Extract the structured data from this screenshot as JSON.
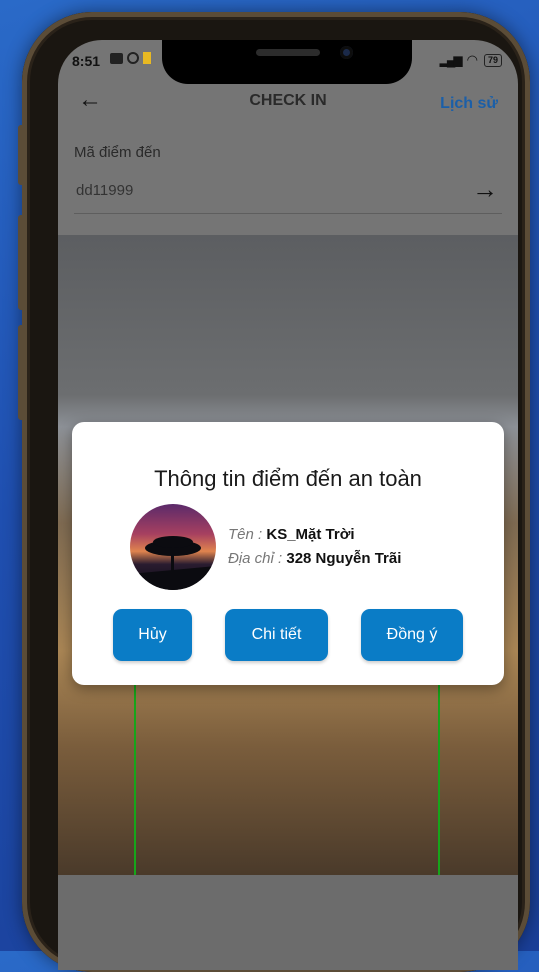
{
  "status_bar": {
    "time": "8:51",
    "battery": "79"
  },
  "header": {
    "title": "CHECK IN",
    "history_link": "Lịch sử"
  },
  "destination": {
    "label": "Mã điểm đến",
    "value": "dd11999"
  },
  "dialog": {
    "title": "Thông tin điểm đến an toàn",
    "name_label": "Tên :",
    "name_value": "KS_Mặt Trời",
    "address_label": "Địa chỉ :",
    "address_value": "328 Nguyễn Trãi",
    "buttons": {
      "cancel": "Hủy",
      "details": "Chi tiết",
      "agree": "Đồng ý"
    }
  },
  "colors": {
    "accent": "#0a7cc6",
    "link": "#1b5fa8",
    "scan_frame": "#16a51a"
  },
  "icons": [
    "back-arrow-icon",
    "forward-arrow-icon",
    "signal-icon",
    "wifi-icon",
    "battery-icon"
  ]
}
